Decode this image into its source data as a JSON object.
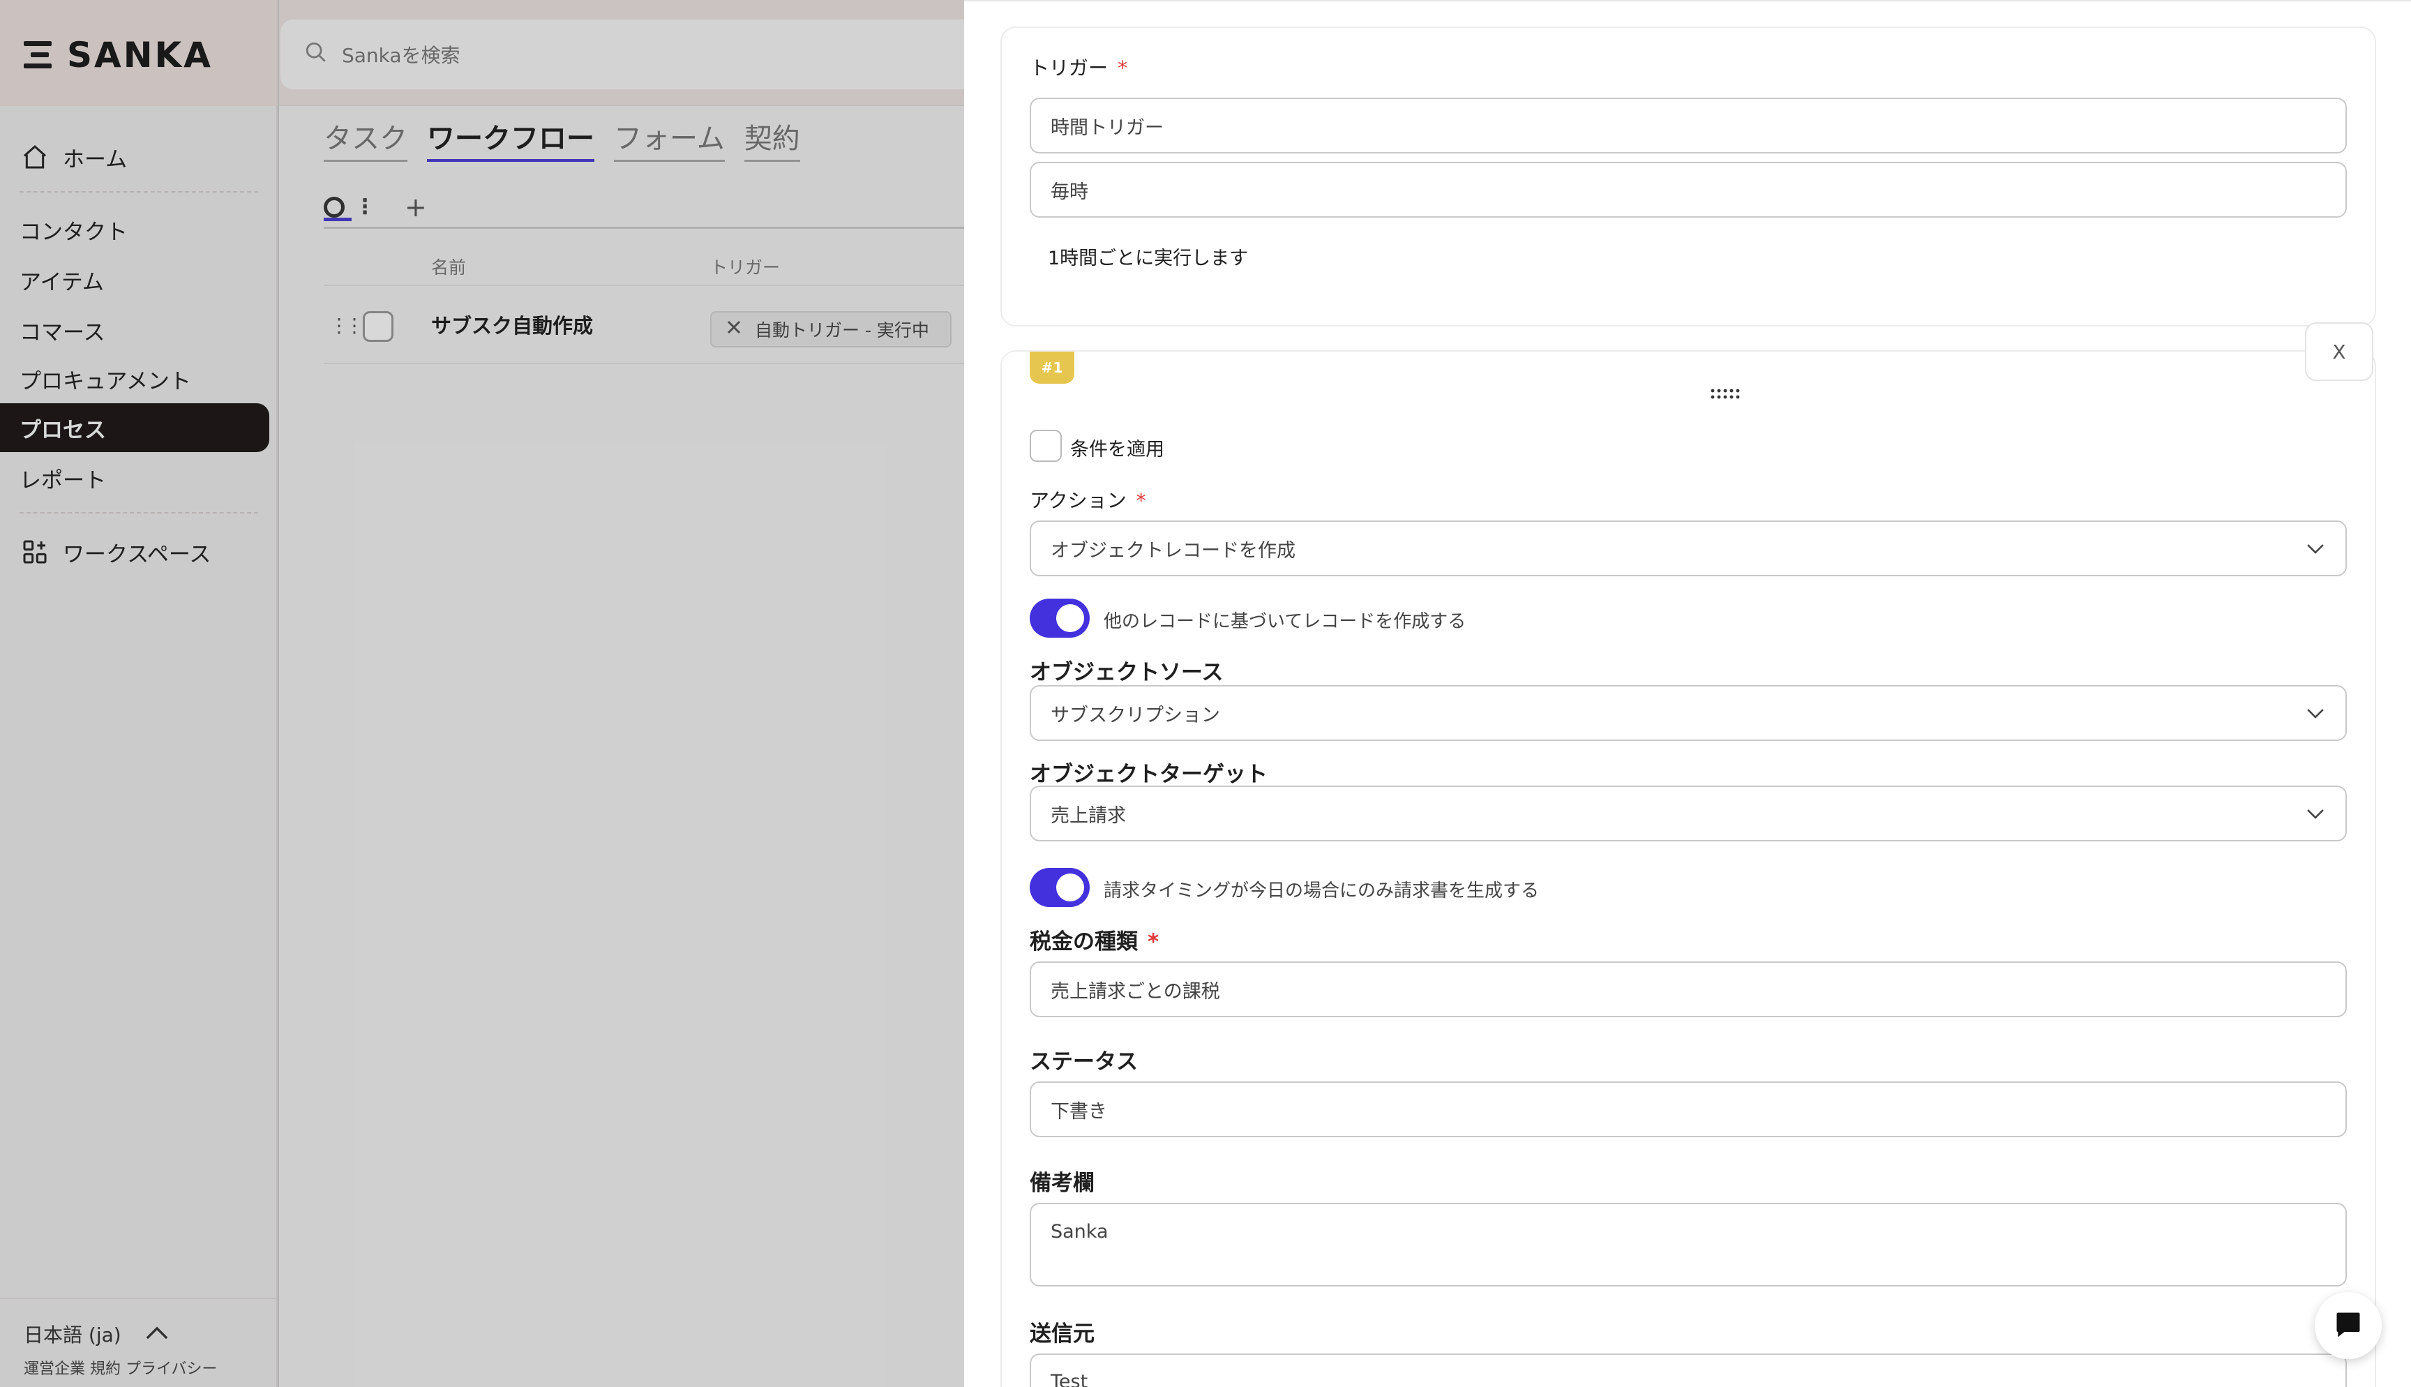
{
  "app": {
    "logo_text": "SANKA",
    "search_placeholder": "Sankaを検索"
  },
  "sidebar": {
    "items": [
      {
        "label": "ホーム"
      },
      {
        "label": "コンタクト"
      },
      {
        "label": "アイテム"
      },
      {
        "label": "コマース"
      },
      {
        "label": "プロキュアメント"
      },
      {
        "label": "プロセス"
      },
      {
        "label": "レポート"
      },
      {
        "label": "ワークスペース"
      }
    ],
    "active_item": "プロセス",
    "language": "日本語 (ja)",
    "footer_links": "運営企業 規約 プライバシー"
  },
  "main": {
    "tabs": [
      {
        "label": "タスク"
      },
      {
        "label": "ワークフロー"
      },
      {
        "label": "フォーム"
      },
      {
        "label": "契約"
      }
    ],
    "active_tab": "ワークフロー",
    "table": {
      "columns": [
        "名前",
        "トリガー"
      ],
      "rows": [
        {
          "name": "サブスク自動作成",
          "trigger": "自動トリガー - 実行中"
        }
      ]
    }
  },
  "panel": {
    "trigger": {
      "label": "トリガー",
      "required_mark": "*",
      "type_value": "時間トリガー",
      "frequency_value": "毎時",
      "description": "1時間ごとに実行します"
    },
    "action": {
      "step_badge": "#1",
      "close_label": "X",
      "condition_label": "条件を適用",
      "action_label": "アクション",
      "action_value": "オブジェクトレコードを作成",
      "toggle_based_on_label": "他のレコードに基づいてレコードを作成する",
      "source_label": "オブジェクトソース",
      "source_value": "サブスクリプション",
      "target_label": "オブジェクトターゲット",
      "target_value": "売上請求",
      "toggle_billing_label": "請求タイミングが今日の場合にのみ請求書を生成する",
      "tax_label": "税金の種類",
      "tax_value": "売上請求ごとの課税",
      "status_label": "ステータス",
      "status_value": "下書き",
      "notes_label": "備考欄",
      "notes_value": "Sanka",
      "sender_label": "送信元",
      "sender_value": "Test"
    }
  },
  "colors": {
    "accent": "#4331de",
    "active_nav_bg": "#1a1313",
    "step_badge": "#e6c64e",
    "required": "#e03a3a"
  }
}
